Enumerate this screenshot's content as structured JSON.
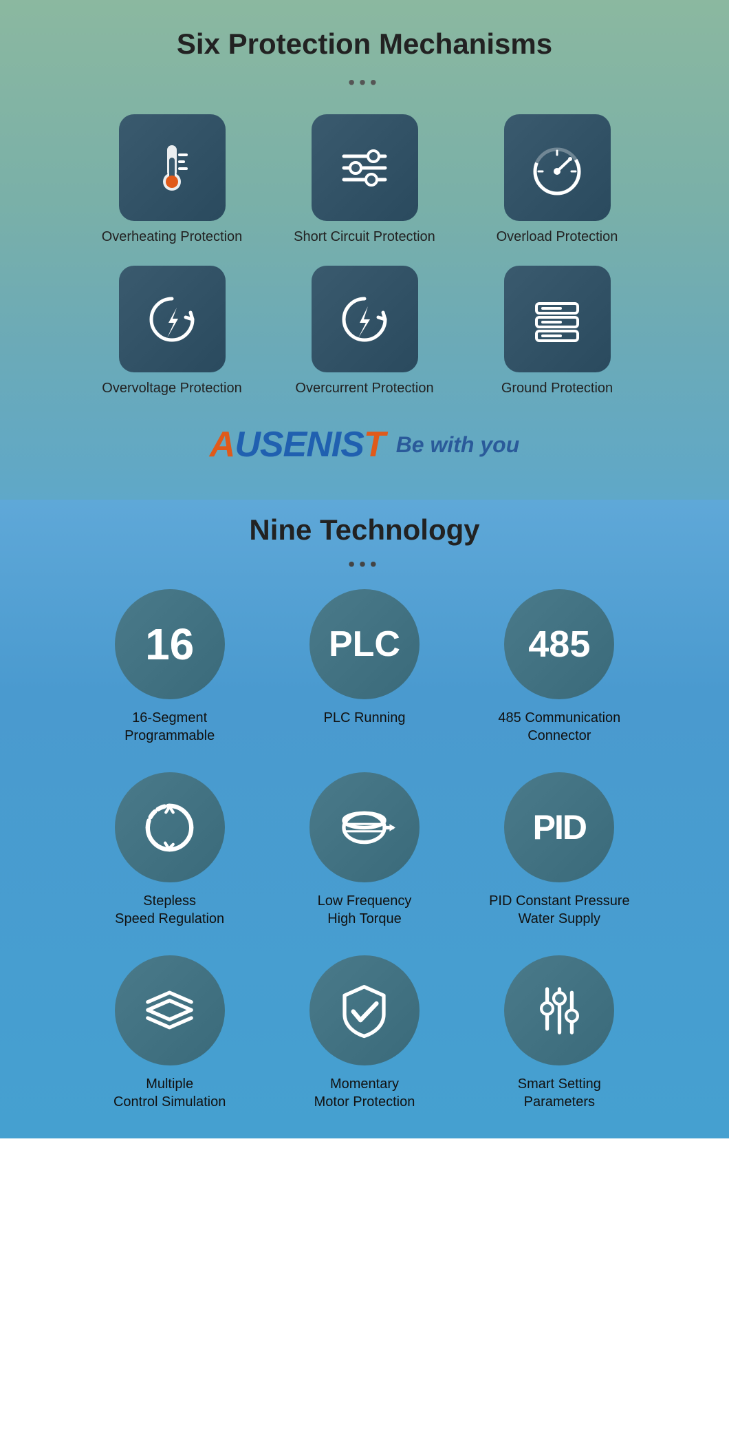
{
  "top": {
    "title": "Six Protection Mechanisms",
    "dots": "•••",
    "protections": [
      {
        "id": "overheating",
        "label": "Overheating Protection",
        "icon": "thermometer"
      },
      {
        "id": "short-circuit",
        "label": "Short Circuit Protection",
        "icon": "sliders"
      },
      {
        "id": "overload",
        "label": "Overload Protection",
        "icon": "gauge"
      },
      {
        "id": "overvoltage",
        "label": "Overvoltage Protection",
        "icon": "lightning-circle"
      },
      {
        "id": "overcurrent",
        "label": "Overcurrent Protection",
        "icon": "lightning-circle2"
      },
      {
        "id": "ground",
        "label": "Ground Protection",
        "icon": "ground"
      }
    ]
  },
  "brand": {
    "logo_text": "AUSENIST",
    "tagline": "Be with you"
  },
  "bottom": {
    "title": "Nine Technology",
    "dots": "•••",
    "technologies": [
      {
        "id": "segment",
        "label": "16-Segment\nProgrammable",
        "display": "16"
      },
      {
        "id": "plc",
        "label": "PLC Running",
        "display": "PLC"
      },
      {
        "id": "comm",
        "label": "485 Communication\nConnector",
        "display": "485"
      },
      {
        "id": "stepless",
        "label": "Stepless\nSpeed Regulation",
        "display": "rotate"
      },
      {
        "id": "lowfreq",
        "label": "Low Frequency\nHigh Torque",
        "display": "motor"
      },
      {
        "id": "pid",
        "label": "PID Constant Pressure\nWater Supply",
        "display": "PID"
      },
      {
        "id": "multi",
        "label": "Multiple\nControl Simulation",
        "display": "layers"
      },
      {
        "id": "momentary",
        "label": "Momentary\nMotor Protection",
        "display": "shield"
      },
      {
        "id": "smart",
        "label": "Smart Setting\nParameters",
        "display": "sliders"
      }
    ]
  }
}
